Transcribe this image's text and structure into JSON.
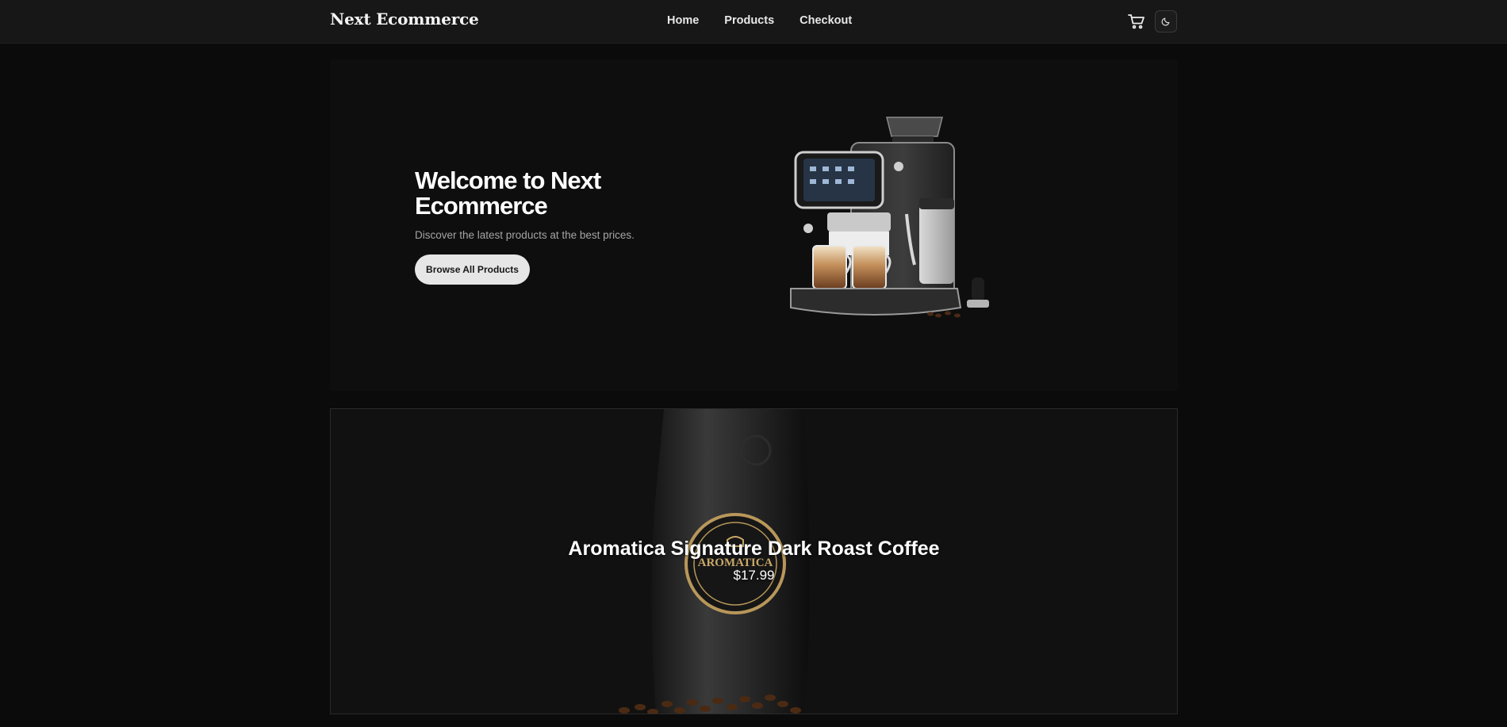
{
  "header": {
    "brand": "Next Ecommerce",
    "nav": [
      {
        "label": "Home"
      },
      {
        "label": "Products"
      },
      {
        "label": "Checkout"
      }
    ],
    "icons": {
      "cart": "cart-icon",
      "theme": "moon-icon"
    }
  },
  "hero": {
    "title": "Welcome to Next Ecommerce",
    "subtitle": "Discover the latest products at the best prices.",
    "cta_label": "Browse All Products",
    "image": "espresso-machine-image"
  },
  "featured": {
    "name": "Aromatica Signature Dark Roast Coffee",
    "price": "$17.99",
    "image": "coffee-bag-image",
    "bag_label": "AROMATICA"
  },
  "colors": {
    "background": "#0b0b0b",
    "navbar": "#171717",
    "button": "#e6e6e6"
  }
}
